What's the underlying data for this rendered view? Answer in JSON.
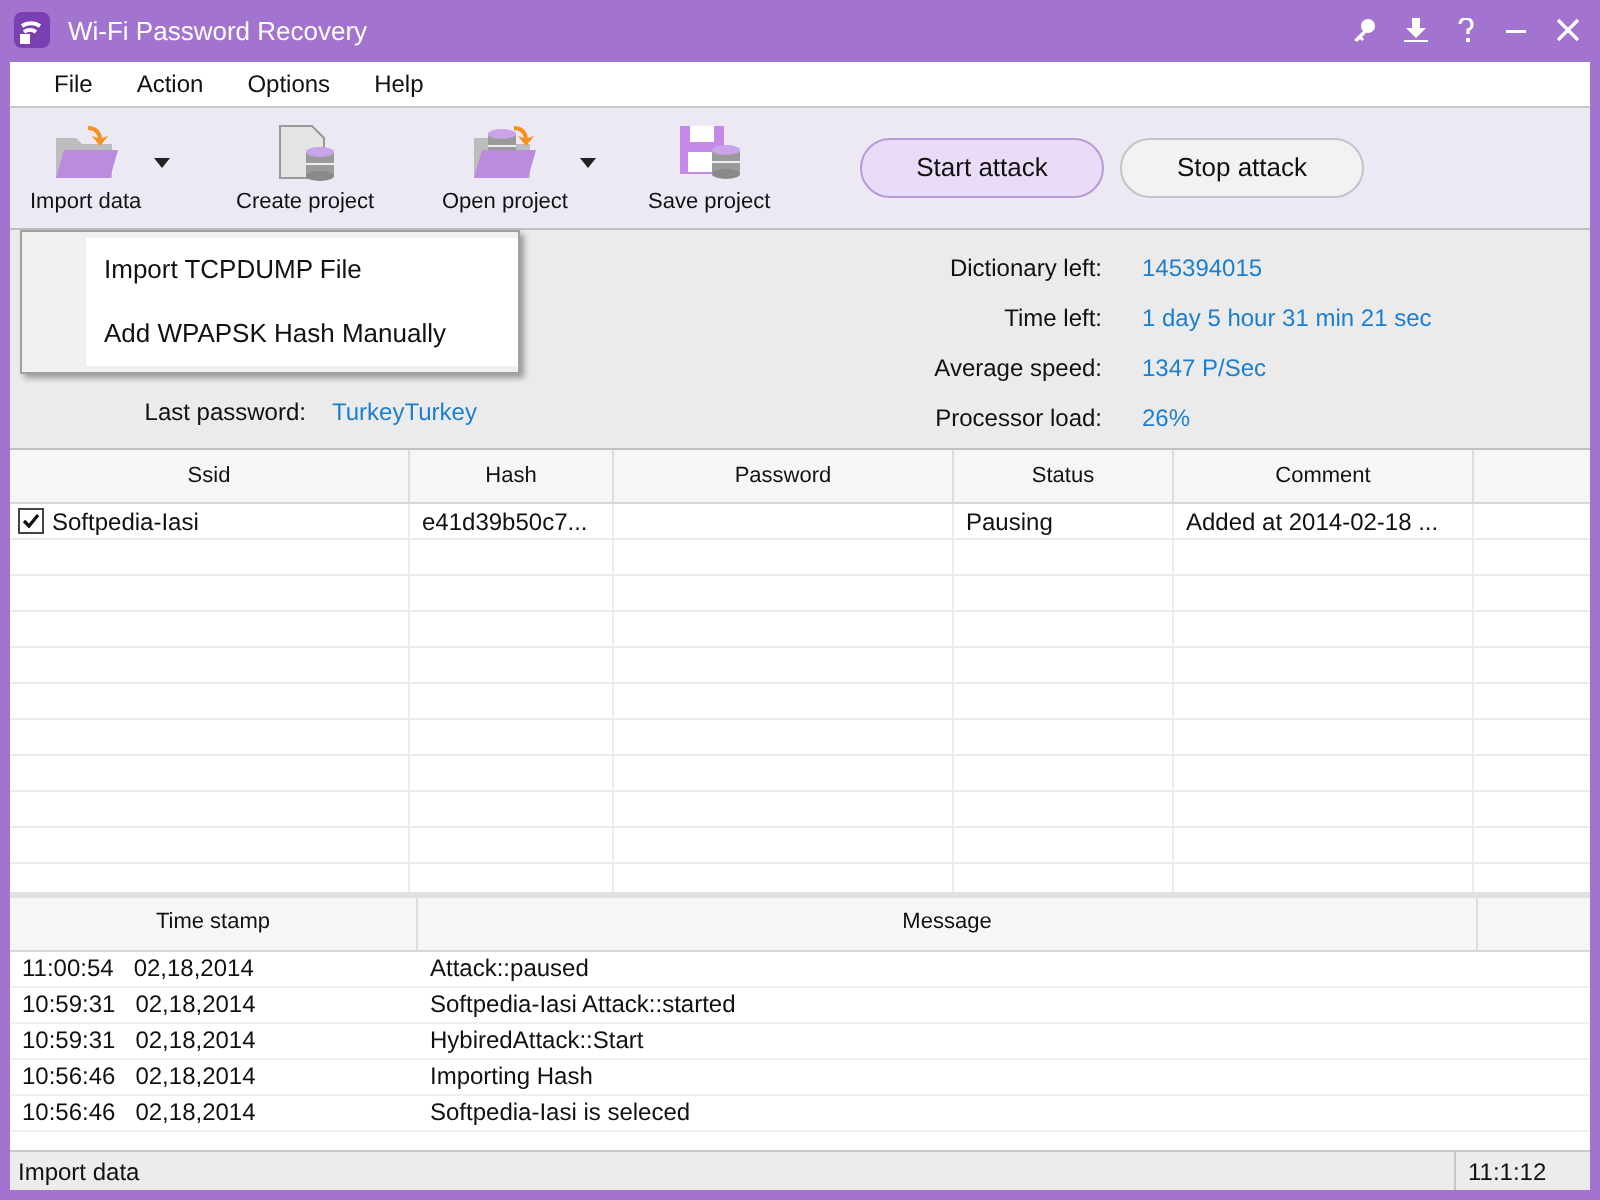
{
  "window": {
    "title": "Wi-Fi Password Recovery"
  },
  "menu": [
    "File",
    "Action",
    "Options",
    "Help"
  ],
  "toolbar": [
    {
      "kind": "import",
      "label": "Import data",
      "has_dropdown": true
    },
    {
      "kind": "create",
      "label": "Create project",
      "has_dropdown": false
    },
    {
      "kind": "open",
      "label": "Open project",
      "has_dropdown": true
    },
    {
      "kind": "save",
      "label": "Save project",
      "has_dropdown": false
    }
  ],
  "attack_buttons": [
    {
      "label": "Start attack",
      "selected": true
    },
    {
      "label": "Stop attack",
      "selected": false
    }
  ],
  "dropdown_menu": [
    "Import TCPDUMP File",
    "Add WPAPSK Hash Manually"
  ],
  "stats_left": [
    {
      "label": "Last password:",
      "value": "TurkeyTurkey"
    }
  ],
  "stats_right": [
    {
      "label": "Dictionary left:",
      "value": "145394015"
    },
    {
      "label": "Time left:",
      "value": "1 day 5 hour 31 min 21 sec"
    },
    {
      "label": "Average speed:",
      "value": "1347 P/Sec"
    },
    {
      "label": "Processor load:",
      "value": "26%"
    }
  ],
  "table": {
    "columns": [
      "Ssid",
      "Hash",
      "Password",
      "Status",
      "Comment"
    ],
    "rows": [
      {
        "checked": true,
        "cells": [
          "Softpedia-Iasi",
          "e41d39b50c7...",
          "",
          "Pausing",
          "Added at 2014-02-18 ..."
        ]
      }
    ]
  },
  "log": {
    "columns": [
      "Time stamp",
      "Message"
    ],
    "rows": [
      {
        "time": "11:00:54",
        "date": "02,18,2014",
        "message": "Attack::paused"
      },
      {
        "time": "10:59:31",
        "date": "02,18,2014",
        "message": "Softpedia-Iasi Attack::started"
      },
      {
        "time": "10:59:31",
        "date": "02,18,2014",
        "message": "HybiredAttack::Start"
      },
      {
        "time": "10:56:46",
        "date": "02,18,2014",
        "message": "Importing Hash"
      },
      {
        "time": "10:56:46",
        "date": "02,18,2014",
        "message": "Softpedia-Iasi is seleced"
      }
    ]
  },
  "status_bar": {
    "message": "Import data",
    "time": "11:1:12"
  }
}
